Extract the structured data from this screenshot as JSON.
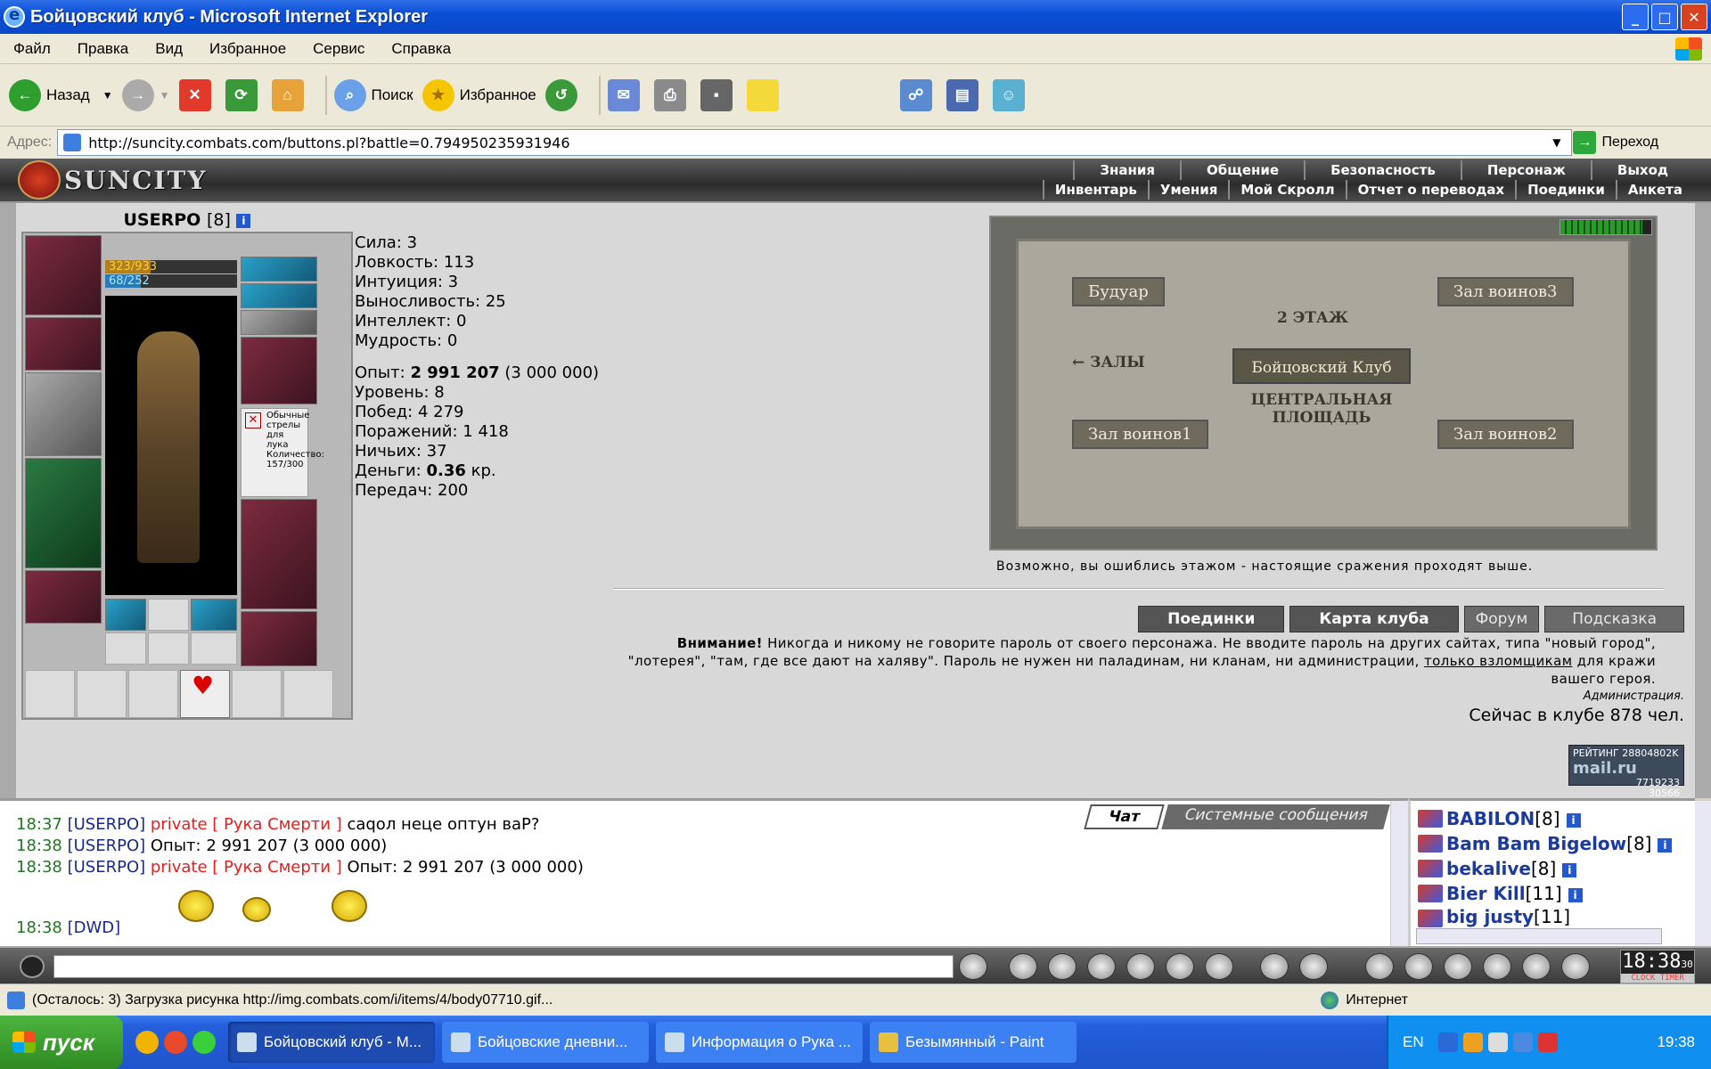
{
  "window": {
    "title": "Бойцовский клуб - Microsoft Internet Explorer",
    "min": "_",
    "max": "□",
    "close": "✕"
  },
  "menu": [
    "Файл",
    "Правка",
    "Вид",
    "Избранное",
    "Сервис",
    "Справка"
  ],
  "toolbar": {
    "back": "Назад",
    "search": "Поиск",
    "favorites": "Избранное"
  },
  "address": {
    "label": "Адрес:",
    "url": "http://suncity.combats.com/buttons.pl?battle=0.794950235931946",
    "go": "Переход"
  },
  "game": {
    "logo": "SUNCITY",
    "nav_top": [
      "Знания",
      "Общение",
      "Безопасность",
      "Персонаж",
      "Выход"
    ],
    "nav_bottom": [
      "Инвентарь",
      "Умения",
      "Мой Скролл",
      "Отчет о переводах",
      "Поединки",
      "Анкета"
    ]
  },
  "character": {
    "name": "USERPO",
    "level": "[8]",
    "hp": "323/933",
    "hp_fraction": 0.346,
    "mp": "68/252",
    "mp_fraction": 0.27,
    "arrows_note": "Обычные стрелы для лука Количество: 157/300",
    "stats": [
      {
        "label": "Сила:",
        "value": "3"
      },
      {
        "label": "Ловкость:",
        "value": "113"
      },
      {
        "label": "Интуиция:",
        "value": "3"
      },
      {
        "label": "Выносливость:",
        "value": "25"
      },
      {
        "label": "Интеллект:",
        "value": "0"
      },
      {
        "label": "Мудрость:",
        "value": "0"
      }
    ],
    "exp_label": "Опыт:",
    "exp": "2 991 207",
    "exp_next": "(3 000 000)",
    "level_label": "Уровень:",
    "level_value": "8",
    "wins_label": "Побед:",
    "wins": "4 279",
    "losses_label": "Поражений:",
    "losses": "1 418",
    "draws_label": "Ничьих:",
    "draws": "37",
    "money_label": "Деньги:",
    "money": "0.36",
    "money_unit": "кр.",
    "transfers_label": "Передач:",
    "transfers": "200"
  },
  "map": {
    "halls": [
      "Будуар",
      "Зал воинов3",
      "Зал воинов1",
      "Зал воинов2"
    ],
    "floor": "2 ЭТАЖ",
    "center": "Бойцовский Клуб",
    "halls_arrow": "← ЗАЛЫ",
    "square": "ЦЕНТРАЛЬНАЯ ПЛОЩАДЬ",
    "note": "Возможно, вы ошиблись этажом - настоящие сражения проходят выше."
  },
  "buttons": [
    "Поединки",
    "Карта клуба",
    "Форум",
    "Подсказка"
  ],
  "warning": {
    "bold": "Внимание!",
    "text1": " Никогда и никому не говорите пароль от своего персонажа. Не вводите пароль на других сайтах, типа \"новый город\", \"лотерея\", \"там, где все дают на халяву\". Пароль не нужен ни паладинам, ни кланам, ни администрации, ",
    "link": "только взломщикам",
    "text2": " для кражи вашего героя.",
    "admin": "Администрация.",
    "online": "Сейчас в клубе 878 чел."
  },
  "rating": {
    "line1": "РЕЙТИНГ 28804802K",
    "brand": "mail.ru",
    "line2": "7719233",
    "line3": "30566"
  },
  "chat": {
    "tabs": [
      "Чат",
      "Системные сообщения"
    ],
    "lines": [
      {
        "time": "18:37",
        "user": "[USERPO]",
        "private": "private [ Рука Смерти ]",
        "text": " сaqол неце оптун ваР?"
      },
      {
        "time": "18:38",
        "user": "[USERPO]",
        "private": "",
        "text": " Опыт: 2 991 207 (3 000 000)"
      },
      {
        "time": "18:38",
        "user": "[USERPO]",
        "private": "private [ Рука Смерти ]",
        "text": " Опыт: 2 991 207 (3 000 000)"
      },
      {
        "time": "18:38",
        "user": "[DWD]",
        "private": "",
        "text": ""
      }
    ]
  },
  "users": [
    {
      "name": "BABILON",
      "level": "[8]"
    },
    {
      "name": "Bam Bam Bigelow",
      "level": "[8]"
    },
    {
      "name": "bekalive",
      "level": "[8]"
    },
    {
      "name": "Bier Kill",
      "level": "[11]"
    },
    {
      "name": "big justy",
      "level": "[11]"
    }
  ],
  "clock": {
    "time": "18:38",
    "sec": "30",
    "label": "CLOCK TIMER"
  },
  "status": {
    "text": "(Осталось: 3) Загрузка рисунка http://img.combats.com/i/items/4/body07710.gif...",
    "zone": "Интернет"
  },
  "taskbar": {
    "start": "пуск",
    "tasks": [
      "Бойцовский клуб - M...",
      "Бойцовские дневни...",
      "Информация о Рука ...",
      "Безымянный - Paint"
    ],
    "lang": "EN",
    "time": "19:38"
  }
}
